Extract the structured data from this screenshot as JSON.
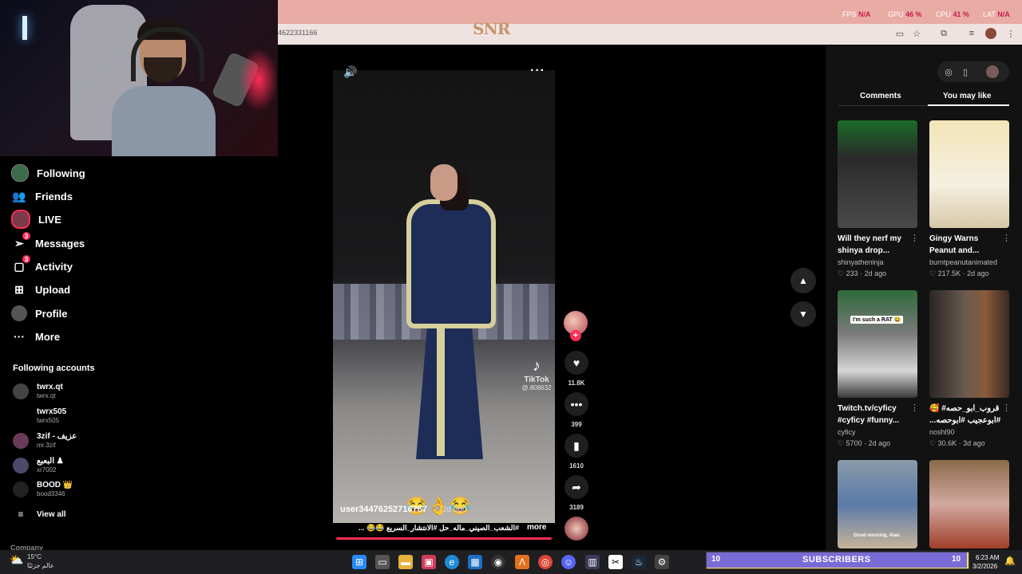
{
  "browser": {
    "url_fragment": "4622331166",
    "overlay_logo": "SNR",
    "stats": [
      {
        "label": "FPS",
        "value": "N/A"
      },
      {
        "label": "GPU",
        "value": "46 %"
      },
      {
        "label": "CPU",
        "value": "41 %"
      },
      {
        "label": "LAT",
        "value": "N/A"
      }
    ]
  },
  "sidebar": {
    "nav": [
      {
        "label": "Following",
        "icon": "following-avatar-icon"
      },
      {
        "label": "Friends",
        "icon": "friends-icon"
      },
      {
        "label": "LIVE",
        "icon": "live-icon"
      },
      {
        "label": "Messages",
        "icon": "messages-icon",
        "badge": "3"
      },
      {
        "label": "Activity",
        "icon": "activity-icon",
        "badge": "3"
      },
      {
        "label": "Upload",
        "icon": "upload-icon"
      },
      {
        "label": "Profile",
        "icon": "profile-avatar-icon"
      },
      {
        "label": "More",
        "icon": "more-icon"
      }
    ],
    "following_title": "Following accounts",
    "accounts": [
      {
        "name": "twrx.qt",
        "handle": "twrx.qt"
      },
      {
        "name": "twrx505",
        "handle": "twrx505"
      },
      {
        "name": "3zif - عزيف",
        "handle": "mr.3zif"
      },
      {
        "name": "البعبع ♟",
        "handle": "xr7002"
      },
      {
        "name": "BOOD 👑",
        "handle": "bood3346"
      }
    ],
    "view_all": "View all",
    "company": "Company"
  },
  "video": {
    "username": "user34476252716767",
    "date": "· 2d ago",
    "emojis": "😂👌😂",
    "caption": "#الشعب_الصيني_ماله_حل #الانتشار_السريع 😂😂 ...",
    "more": "more",
    "watermark": {
      "brand": "TikTok",
      "id": "@.808632"
    },
    "progress_percent": 100
  },
  "actions": {
    "likes": "11.8K",
    "comments": "399",
    "saves": "1610",
    "shares": "3189"
  },
  "right_panel": {
    "tabs": [
      "Comments",
      "You may like"
    ],
    "active_tab": "You may like",
    "recommendations": [
      {
        "title": "Will they nerf my shinya drop...",
        "author": "shinyatheninja",
        "likes": "233",
        "age": "2d ago"
      },
      {
        "title": "Gingy Warns Peanut and...",
        "author": "burntpeanutanimated",
        "likes": "217.5K",
        "age": "2d ago"
      },
      {
        "title": "Twitch.tv/cyficy #cyficy #funny...",
        "author": "cyficy",
        "likes": "5700",
        "age": "2d ago",
        "thumb_text": "I'm such a RAT 😂"
      },
      {
        "title": "قروب_ابو_حصه# 🥰 #ابوعجيب #ابوحصه...",
        "author": "noshl90",
        "likes": "30.6K",
        "age": "3d ago"
      },
      {
        "title": "",
        "author": "",
        "likes": "",
        "age": "",
        "thumb_text": "Good morning, Alan."
      },
      {
        "title": "",
        "author": "",
        "likes": "",
        "age": ""
      }
    ]
  },
  "taskbar": {
    "weather_temp": "15°C",
    "weather_desc": "عالم جزئيًا",
    "subs_left": "10",
    "subs_label": "SUBSCRIBERS",
    "subs_right": "10",
    "time": "6:23 AM",
    "date": "3/2/2026"
  }
}
